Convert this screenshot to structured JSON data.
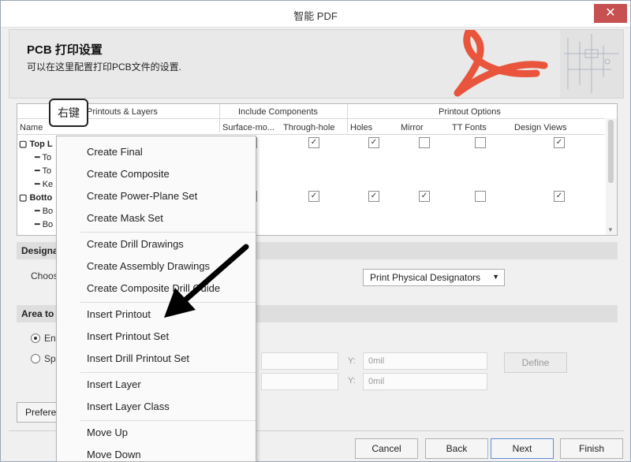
{
  "window": {
    "title": "智能 PDF",
    "close_glyph": "✕"
  },
  "header": {
    "title": "PCB 打印设置",
    "subtitle": "可以在这里配置打印PCB文件的设置."
  },
  "table": {
    "group_headers": [
      "Printouts & Layers",
      "Include Components",
      "Printout Options"
    ],
    "columns": [
      "Name",
      "Surface-mo...",
      "Through-hole",
      "Holes",
      "Mirror",
      "TT Fonts",
      "Design Views"
    ],
    "rows": [
      {
        "label": "Top L",
        "checks": [
          false,
          true,
          true,
          false,
          false,
          true
        ]
      },
      {
        "label": "To"
      },
      {
        "label": "To"
      },
      {
        "label": "Ke"
      },
      {
        "label": "Botto",
        "checks": [
          false,
          true,
          true,
          true,
          false,
          true
        ]
      },
      {
        "label": "Bo"
      },
      {
        "label": "Bo"
      }
    ]
  },
  "designators": {
    "group_label": "Designa",
    "choose_label": "Choos",
    "dropdown_value": "Print Physical Designators"
  },
  "area": {
    "group_label": "Area to",
    "radio_entire": "Ent",
    "radio_specific": "Sp",
    "y_label": "Y:",
    "y1_value": "0mil",
    "y2_value": "0mil",
    "define_button": "Define"
  },
  "preferences_button": "Prefere",
  "footer": {
    "cancel": "Cancel",
    "back": "Back",
    "next": "Next",
    "finish": "Finish"
  },
  "annotation": {
    "callout": "右键"
  },
  "context_menu": {
    "items": [
      "Create Final",
      "Create Composite",
      "Create Power-Plane Set",
      "Create Mask Set",
      "Create Drill Drawings",
      "Create Assembly Drawings",
      "Create Composite Drill Guide",
      "Insert Printout",
      "Insert Printout Set",
      "Insert Drill Printout Set",
      "Insert Layer",
      "Insert Layer Class",
      "Move Up",
      "Move Down"
    ]
  },
  "colors": {
    "accent": "#e8553c",
    "close": "#c75050",
    "primary_border": "#5c8fd3"
  }
}
